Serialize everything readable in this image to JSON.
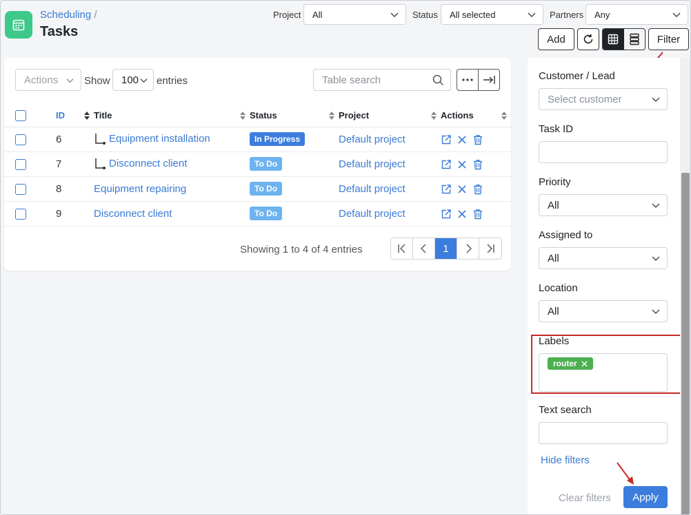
{
  "header": {
    "breadcrumb_parent": "Scheduling",
    "breadcrumb_sep": "/",
    "title": "Tasks",
    "project_label": "Project",
    "project_value": "All",
    "status_label": "Status",
    "status_value": "All selected",
    "partners_label": "Partners",
    "partners_value": "Any"
  },
  "toolbar": {
    "add_label": "Add",
    "filter_label": "Filter"
  },
  "table_controls": {
    "actions_label": "Actions",
    "show_label": "Show",
    "entries_count": "100",
    "entries_label": "entries",
    "search_placeholder": "Table search"
  },
  "table": {
    "columns": [
      "ID",
      "Title",
      "Status",
      "Project",
      "Actions"
    ],
    "rows": [
      {
        "id": "6",
        "title": "Equipment installation",
        "subtask": true,
        "status": "In Progress",
        "project": "Default project"
      },
      {
        "id": "7",
        "title": "Disconnect client",
        "subtask": true,
        "status": "To Do",
        "project": "Default project"
      },
      {
        "id": "8",
        "title": "Equipment repairing",
        "subtask": false,
        "status": "To Do",
        "project": "Default project"
      },
      {
        "id": "9",
        "title": "Disconnect client",
        "subtask": false,
        "status": "To Do",
        "project": "Default project"
      }
    ]
  },
  "pagination": {
    "summary": "Showing 1 to 4 of 4 entries",
    "current_page": "1"
  },
  "filters": {
    "customer_label": "Customer / Lead",
    "customer_placeholder": "Select customer",
    "task_id_label": "Task ID",
    "priority_label": "Priority",
    "priority_value": "All",
    "assigned_label": "Assigned to",
    "assigned_value": "All",
    "location_label": "Location",
    "location_value": "All",
    "labels_label": "Labels",
    "label_tag": "router",
    "text_search_label": "Text search",
    "hide_filters": "Hide filters",
    "clear_filters": "Clear filters",
    "apply": "Apply"
  },
  "colors": {
    "accent": "#3b7ddd",
    "app_icon": "#3ec98a",
    "tag": "#4caf50",
    "highlight": "#c62828"
  }
}
